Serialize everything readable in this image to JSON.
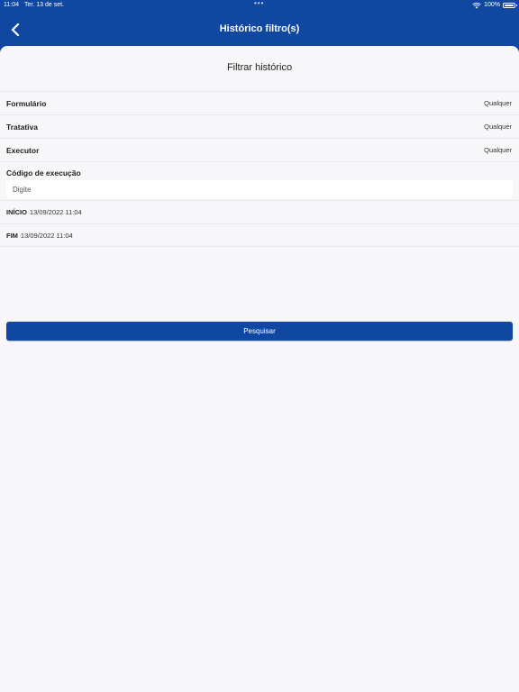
{
  "status_bar": {
    "time": "11:04",
    "date": "Ter. 13 de set.",
    "battery": "100%"
  },
  "header": {
    "title": "Histórico filtro(s)"
  },
  "filter": {
    "title": "Filtrar histórico",
    "rows": [
      {
        "label": "Formulário",
        "value": "Qualquer"
      },
      {
        "label": "Tratativa",
        "value": "Qualquer"
      },
      {
        "label": "Executor",
        "value": "Qualquer"
      }
    ],
    "code": {
      "label": "Código de execução",
      "placeholder": "Digite",
      "value": ""
    },
    "start": {
      "label": "INÍCIO",
      "value": "13/09/2022 11:04"
    },
    "end": {
      "label": "FIM",
      "value": "13/09/2022 11:04"
    },
    "search_label": "Pesquisar"
  },
  "colors": {
    "primary": "#0f47a1",
    "background": "#f7f7f9"
  }
}
